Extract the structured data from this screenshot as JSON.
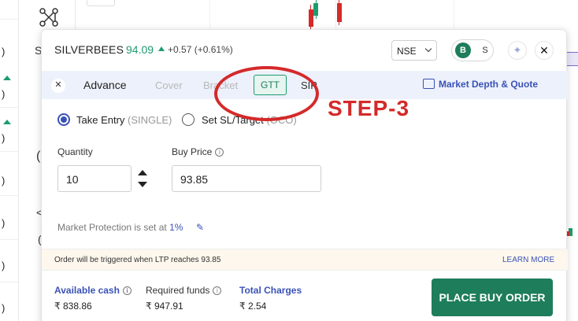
{
  "background": {
    "left_glyphs": [
      ")",
      ")",
      ")",
      ")",
      ")",
      ")",
      ")",
      ")",
      ")"
    ],
    "col2_glyphs": [
      "S",
      "(",
      "(",
      "<",
      "("
    ]
  },
  "order_window": {
    "symbol": "SILVERBEES",
    "ltp": "94.09",
    "change": "+0.57",
    "change_pct": "(+0.61%)",
    "exchange": "NSE",
    "buy_label": "B",
    "sell_label": "S",
    "tabs": {
      "advance": "Advance",
      "cover": "Cover",
      "bracket": "Bracket",
      "gtt": "GTT",
      "sip": "SIP"
    },
    "market_depth_link": "Market Depth & Quote",
    "entry_options": [
      {
        "label": "Take Entry",
        "sub": "(SINGLE)",
        "selected": true
      },
      {
        "label": "Set SL/Target",
        "sub": "(OCO)",
        "selected": false
      }
    ],
    "quantity_label": "Quantity",
    "quantity_value": "10",
    "buy_price_label": "Buy Price",
    "buy_price_value": "93.85",
    "protection_text": "Market Protection is set at",
    "protection_value": "1%",
    "notice": "Order will be triggered when LTP reaches 93.85",
    "learn_more": "LEARN MORE",
    "available_cash_label": "Available cash",
    "available_cash_value": "₹ 838.86",
    "required_funds_label": "Required funds",
    "required_funds_value": "₹ 947.91",
    "total_charges_label": "Total Charges",
    "total_charges_value": "₹ 2.54",
    "place_order": "PLACE BUY ORDER"
  },
  "annotation": {
    "step_label": "STEP-3",
    "color": "#d42a2a"
  },
  "colors": {
    "accent_green": "#1e7d5b",
    "ltp_green": "#1e9b6f",
    "link_blue": "#3a52b6",
    "tab_bar_bg": "#edf1fb"
  }
}
